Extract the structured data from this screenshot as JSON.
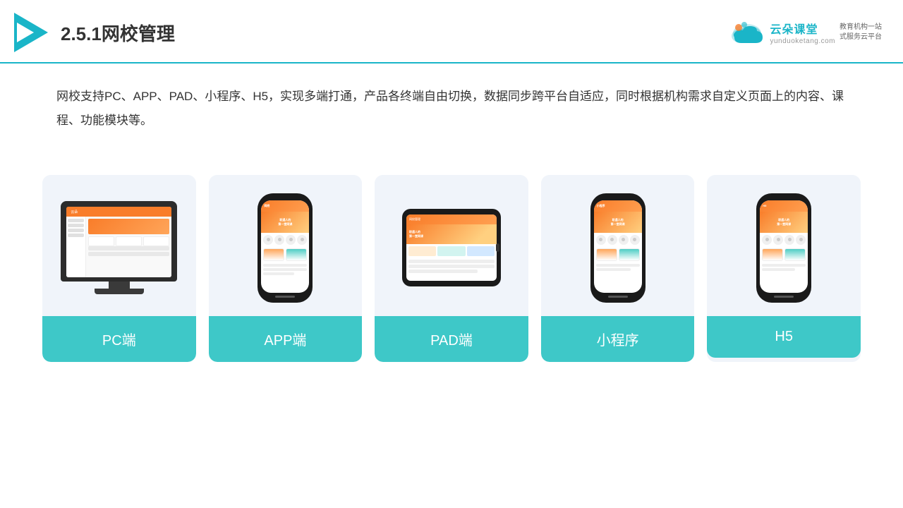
{
  "header": {
    "title": "2.5.1网校管理",
    "brand_name": "云朵课堂",
    "brand_url": "yunduoketang.com",
    "brand_tagline": "教育机构一站\n式服务云平台"
  },
  "description": {
    "text": "网校支持PC、APP、PAD、小程序、H5，实现多端打通，产品各终端自由切换，数据同步跨平台自适应，同时根据机构需求自定义页面上的内容、课程、功能模块等。"
  },
  "cards": [
    {
      "label": "PC端",
      "id": "pc"
    },
    {
      "label": "APP端",
      "id": "app"
    },
    {
      "label": "PAD端",
      "id": "pad"
    },
    {
      "label": "小程序",
      "id": "miniapp"
    },
    {
      "label": "H5",
      "id": "h5"
    }
  ]
}
